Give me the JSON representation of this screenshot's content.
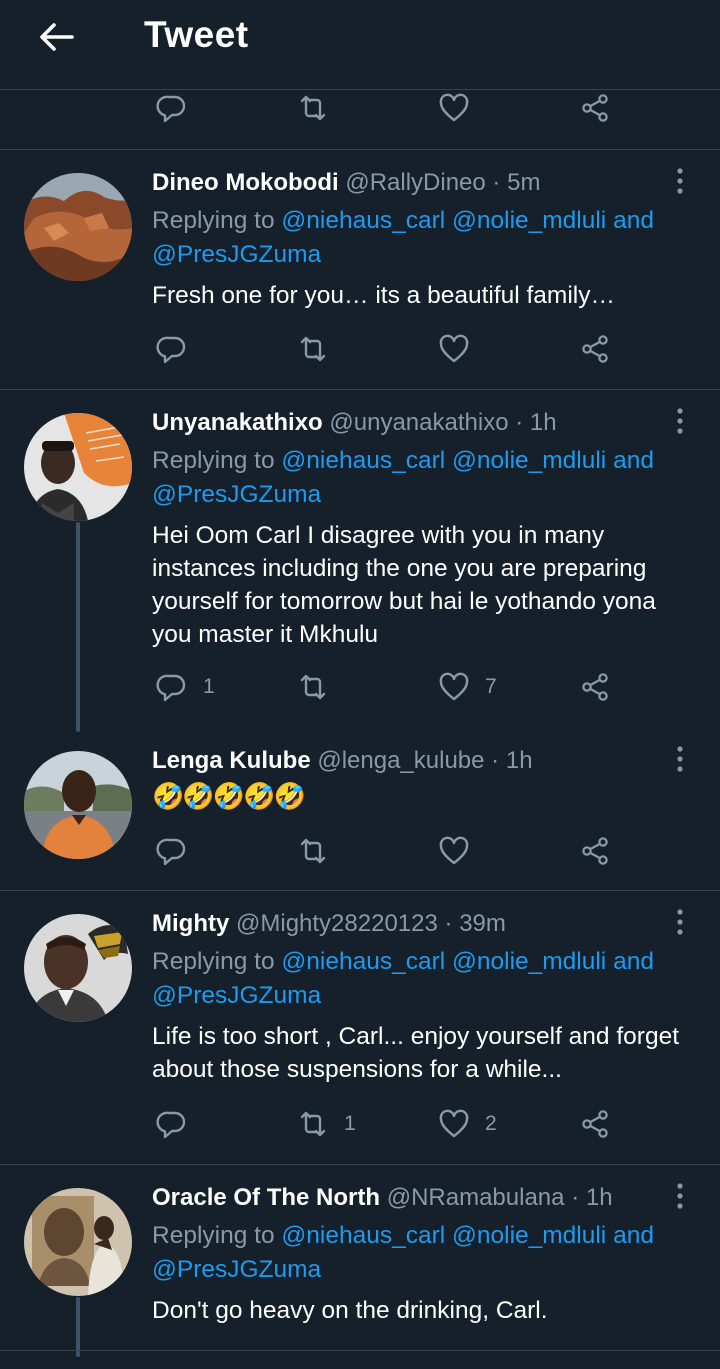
{
  "header": {
    "title": "Tweet"
  },
  "reply_prefix": "Replying to",
  "mentions": [
    "@niehaus_carl",
    "@nolie_mdluli",
    "and",
    "@PresJGZuma"
  ],
  "separator": "·",
  "tweets": [
    {
      "name": "Dineo Mokobodi",
      "handle": "@RallyDineo",
      "time": "5m",
      "text": "Fresh one for you… its a beautiful family…",
      "reply_count": "",
      "retweet_count": "",
      "like_count": ""
    },
    {
      "name": "Unyanakathixo",
      "handle": "@unyanakathixo",
      "time": "1h",
      "text": "Hei Oom Carl I disagree with you in many instances including the one you are preparing yourself for tomorrow but hai le yothando yona you  master it Mkhulu",
      "reply_count": "1",
      "retweet_count": "",
      "like_count": "7"
    },
    {
      "name": "Lenga Kulube",
      "handle": "@lenga_kulube",
      "time": "1h",
      "text": "🤣🤣🤣🤣🤣",
      "reply_count": "",
      "retweet_count": "",
      "like_count": ""
    },
    {
      "name": "Mighty",
      "handle": "@Mighty28220123",
      "time": "39m",
      "text": "Life is too short , Carl... enjoy yourself and forget about those suspensions for a while...",
      "reply_count": "",
      "retweet_count": "1",
      "like_count": "2"
    },
    {
      "name": "Oracle Of The North",
      "handle": "@NRamabulana",
      "time": "1h",
      "text": "Don't go heavy on the drinking, Carl.",
      "reply_count": "",
      "retweet_count": "",
      "like_count": ""
    }
  ],
  "icons": [
    "back-arrow-icon",
    "reply-icon",
    "retweet-icon",
    "like-icon",
    "share-icon",
    "more-icon"
  ],
  "colors": {
    "background": "#15202b",
    "link": "#1d9bf0",
    "secondary_text": "#8b98a5",
    "divider": "#38444d",
    "thread_line": "#3d5466"
  }
}
